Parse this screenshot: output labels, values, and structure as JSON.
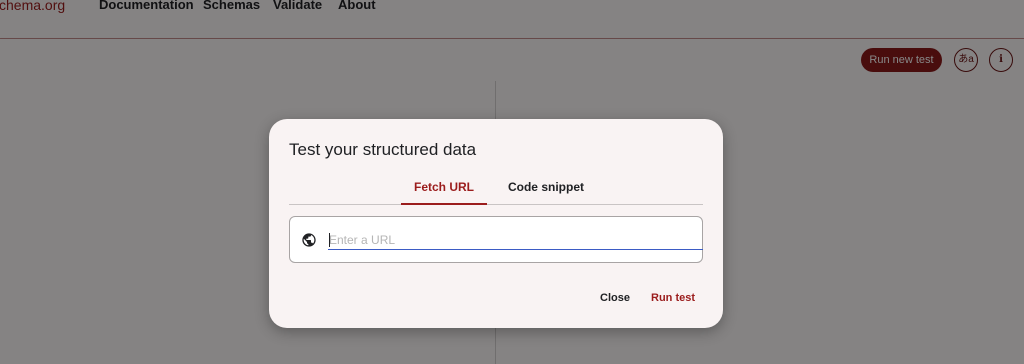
{
  "header": {
    "logo_text": "chema.org",
    "nav": [
      "Documentation",
      "Schemas",
      "Validate",
      "About"
    ]
  },
  "toolbar": {
    "run_new_test_label": "Run new test",
    "language_icon_text": "あa",
    "info_icon_text": "i"
  },
  "dialog": {
    "title": "Test your structured data",
    "tabs": [
      {
        "label": "Fetch URL",
        "active": true
      },
      {
        "label": "Code snippet",
        "active": false
      }
    ],
    "url_input": {
      "placeholder": "Enter a URL",
      "value": ""
    },
    "close_label": "Close",
    "run_label": "Run test"
  },
  "colors": {
    "accent": "#9b1c1c",
    "accent_dark": "#8a1a1a",
    "input_focus": "#3b5bc5"
  },
  "icons": {
    "url_prefix": "globe-icon",
    "language": "translate-icon",
    "info": "info-icon"
  }
}
